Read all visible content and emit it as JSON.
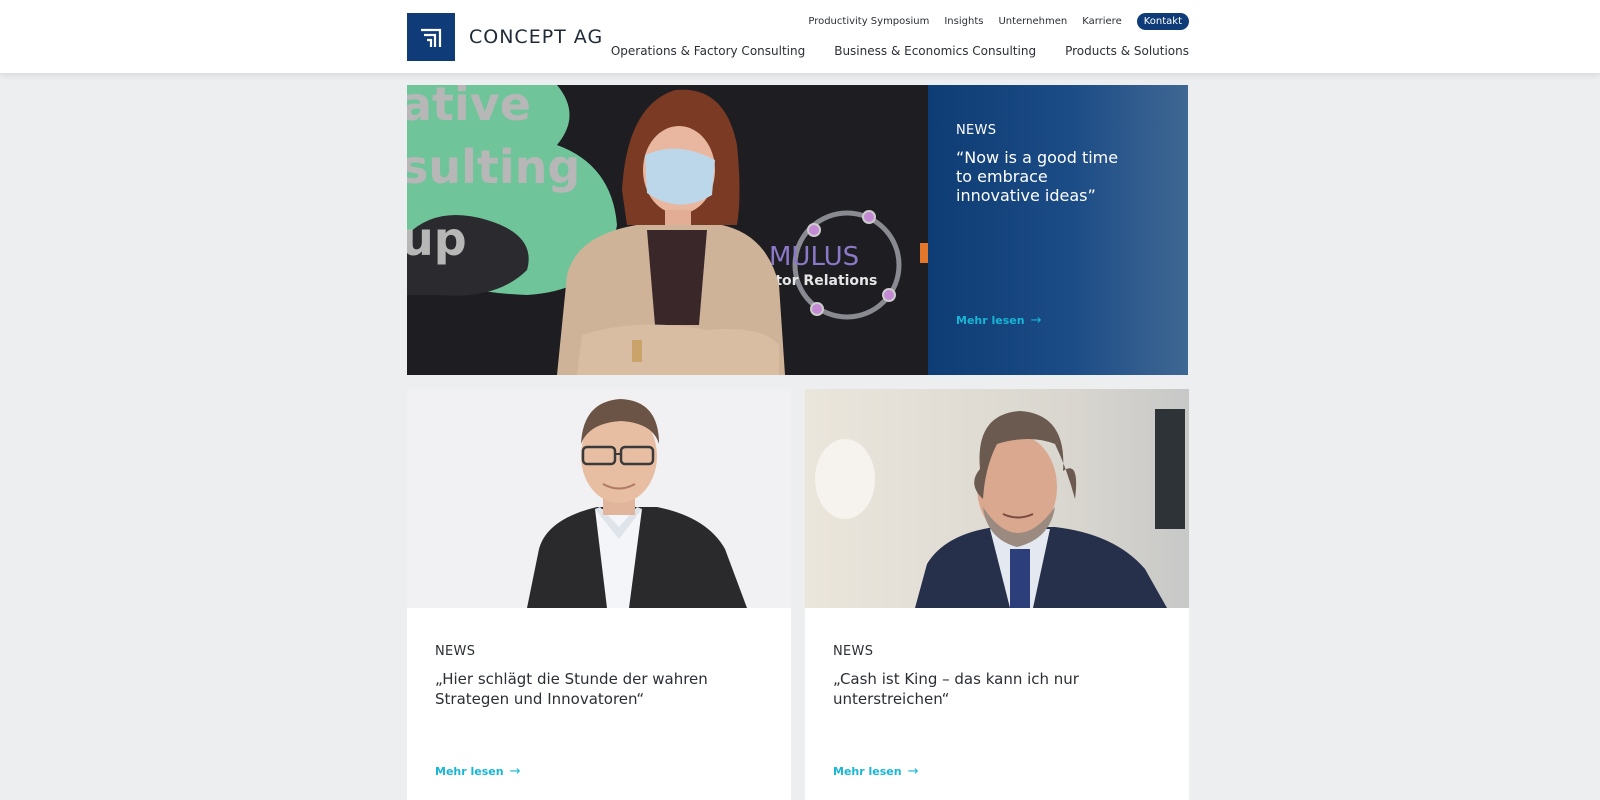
{
  "brand": {
    "name": "CONCEPT AG",
    "logo_color": "#0f3c78"
  },
  "top_nav": [
    "Productivity Symposium",
    "Insights",
    "Unternehmen",
    "Karriere"
  ],
  "contact_label": "Kontakt",
  "main_nav": [
    "Operations & Factory Consulting",
    "Business & Economics Consulting",
    "Products & Solutions"
  ],
  "hero": {
    "kicker": "NEWS",
    "title": "“Now is a good time to embrace innovative ideas”",
    "link": "Mehr lesen",
    "image_text": {
      "word1": "ative",
      "word2": "sulting",
      "word3": "up",
      "sign1": "MULUS",
      "sign2": "stor Relations"
    }
  },
  "cards": [
    {
      "kicker": "NEWS",
      "title": "„Hier schlägt die Stunde der wahren Strategen und Innovatoren“",
      "link": "Mehr lesen"
    },
    {
      "kicker": "NEWS",
      "title": "„Cash ist King – das kann ich nur unterstreichen“",
      "link": "Mehr lesen"
    }
  ],
  "colors": {
    "accent": "#18b6d6",
    "navy": "#0e3c74",
    "background": "#eceef0"
  }
}
